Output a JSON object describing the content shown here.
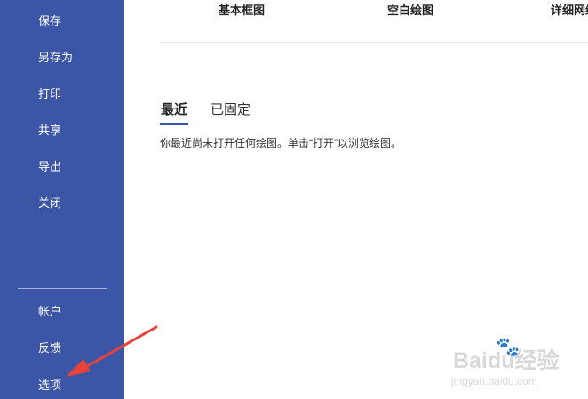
{
  "sidebar": {
    "items_top": [
      "保存",
      "另存为",
      "打印",
      "共享",
      "导出",
      "关闭"
    ],
    "items_bottom": [
      "帐户",
      "反馈",
      "选项"
    ]
  },
  "templates": {
    "labels": [
      "基本框图",
      "空白绘图",
      "详细网络"
    ]
  },
  "recent": {
    "tabs": [
      "最近",
      "已固定"
    ],
    "active_tab": "最近",
    "empty_message": "你最近尚未打开任何绘图。单击“打开”以浏览绘图。"
  },
  "annotation": {
    "arrow_color": "#e8423b"
  },
  "watermark": {
    "main": "Baidu经验",
    "sub": "jingyan.baidu.com"
  },
  "colors": {
    "sidebar_bg": "#3b56a7",
    "accent": "#3b56a7"
  }
}
